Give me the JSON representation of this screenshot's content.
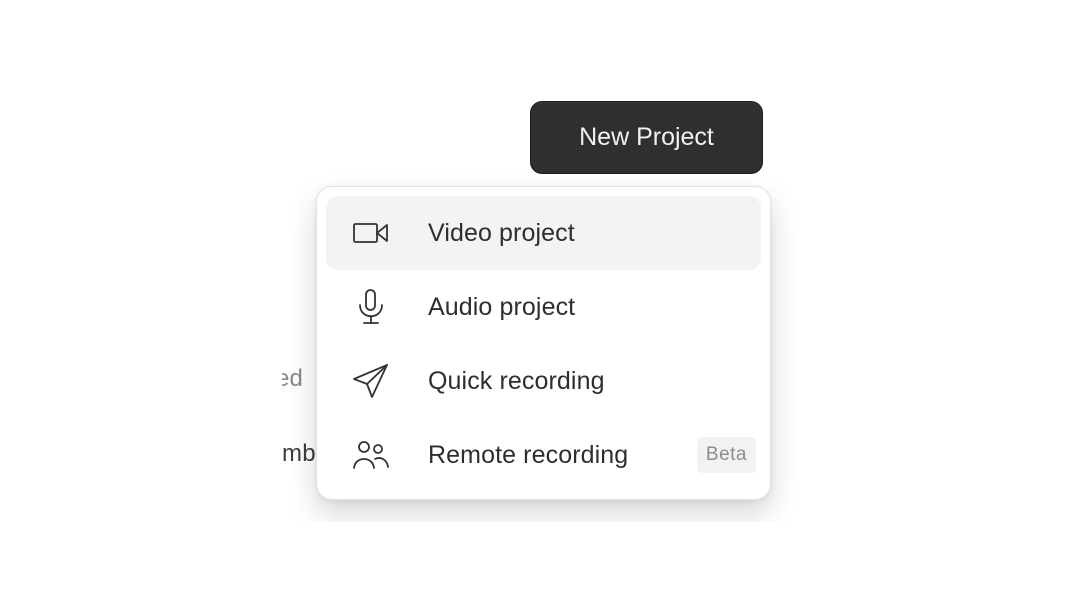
{
  "header": {
    "new_project_label": "New Project"
  },
  "background": {
    "fragments": [
      "ed",
      "mb"
    ]
  },
  "menu": {
    "items": [
      {
        "label": "Video project",
        "icon": "video-camera-icon",
        "active": true
      },
      {
        "label": "Audio project",
        "icon": "microphone-icon",
        "active": false
      },
      {
        "label": "Quick recording",
        "icon": "paper-plane-icon",
        "active": false
      },
      {
        "label": "Remote recording",
        "icon": "users-icon",
        "active": false,
        "badge": "Beta"
      }
    ]
  },
  "colors": {
    "button_bg": "#2f2f2f",
    "button_text": "#f1f1f1",
    "menu_bg": "#ffffff",
    "active_item_bg": "#f3f3f3",
    "badge_bg": "#f2f2f2",
    "badge_text": "#8c8c8c"
  }
}
